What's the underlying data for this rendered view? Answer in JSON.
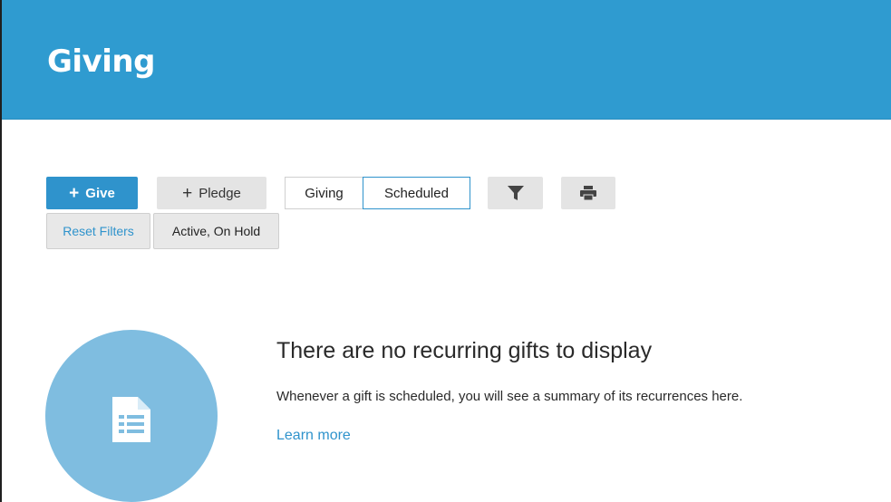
{
  "header": {
    "title": "Giving"
  },
  "toolbar": {
    "give_label": "Give",
    "pledge_label": "Pledge",
    "view_toggle": {
      "items": [
        "Giving",
        "Scheduled"
      ],
      "selected": "Scheduled"
    },
    "filter_icon": "filter-icon",
    "print_icon": "print-icon"
  },
  "filters": {
    "reset_label": "Reset Filters",
    "active_filter": "Active, On Hold"
  },
  "empty_state": {
    "icon": "document-list-icon",
    "title": "There are no recurring gifts to display",
    "description": "Whenever a gift is scheduled, you will see a summary of its recurrences here.",
    "link_label": "Learn more"
  },
  "colors": {
    "header_bg": "#2f9bd0",
    "primary": "#2f93cc",
    "circle": "#7fbde0",
    "button_gray": "#e4e4e4"
  }
}
